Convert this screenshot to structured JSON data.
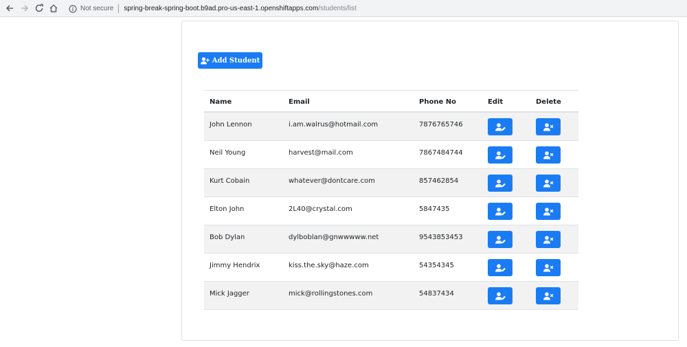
{
  "browser": {
    "security_label": "Not secure",
    "url_host": "spring-break-spring-boot.b9ad.pro-us-east-1.openshiftapps.com",
    "url_path": "/students/list",
    "icons": [
      "back-arrow-icon",
      "forward-arrow-icon",
      "reload-icon",
      "home-icon",
      "info-icon"
    ]
  },
  "page": {
    "add_button_label": "Add Student",
    "accent_color": "#1a7cf4"
  },
  "table": {
    "headers": {
      "name": "Name",
      "email": "Email",
      "phone": "Phone No",
      "edit": "Edit",
      "delete": "Delete"
    },
    "rows": [
      {
        "name": "John Lennon",
        "email": "i.am.walrus@hotmail.com",
        "phone": "7876765746"
      },
      {
        "name": "Neil Young",
        "email": "harvest@mail.com",
        "phone": "7867484744"
      },
      {
        "name": "Kurt Cobain",
        "email": "whatever@dontcare.com",
        "phone": "857462854"
      },
      {
        "name": "Elton John",
        "email": "2L40@crystal.com",
        "phone": "5847435"
      },
      {
        "name": "Bob Dylan",
        "email": "dylboblan@gnwwwww.net",
        "phone": "9543853453"
      },
      {
        "name": "Jimmy Hendrix",
        "email": "kiss.the.sky@haze.com",
        "phone": "54354345"
      },
      {
        "name": "Mick Jagger",
        "email": "mick@rollingstones.com",
        "phone": "54837434"
      }
    ]
  }
}
